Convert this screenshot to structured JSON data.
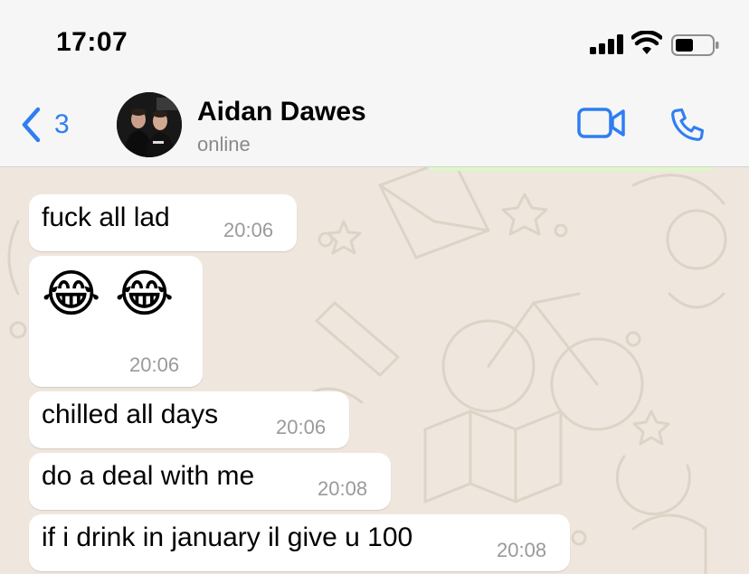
{
  "status_bar": {
    "time": "17:07"
  },
  "header": {
    "back_count": "3",
    "contact_name": "Aidan Dawes",
    "contact_status": "online",
    "icons": [
      "chevron-left-icon",
      "video-call-icon",
      "phone-call-icon"
    ]
  },
  "messages": [
    {
      "text": "fuck all lad",
      "time": "20:06"
    },
    {
      "text": "😂 😂",
      "time": "20:06"
    },
    {
      "text": "chilled all days",
      "time": "20:06"
    },
    {
      "text": "do a deal with me",
      "time": "20:08"
    },
    {
      "text": "if i drink in january il give u 100",
      "time": "20:08"
    }
  ],
  "colors": {
    "accent": "#2f7ef2",
    "chat_bg": "#efe7dd",
    "bubble_in": "#ffffff",
    "bubble_out": "#dcf8c6"
  }
}
